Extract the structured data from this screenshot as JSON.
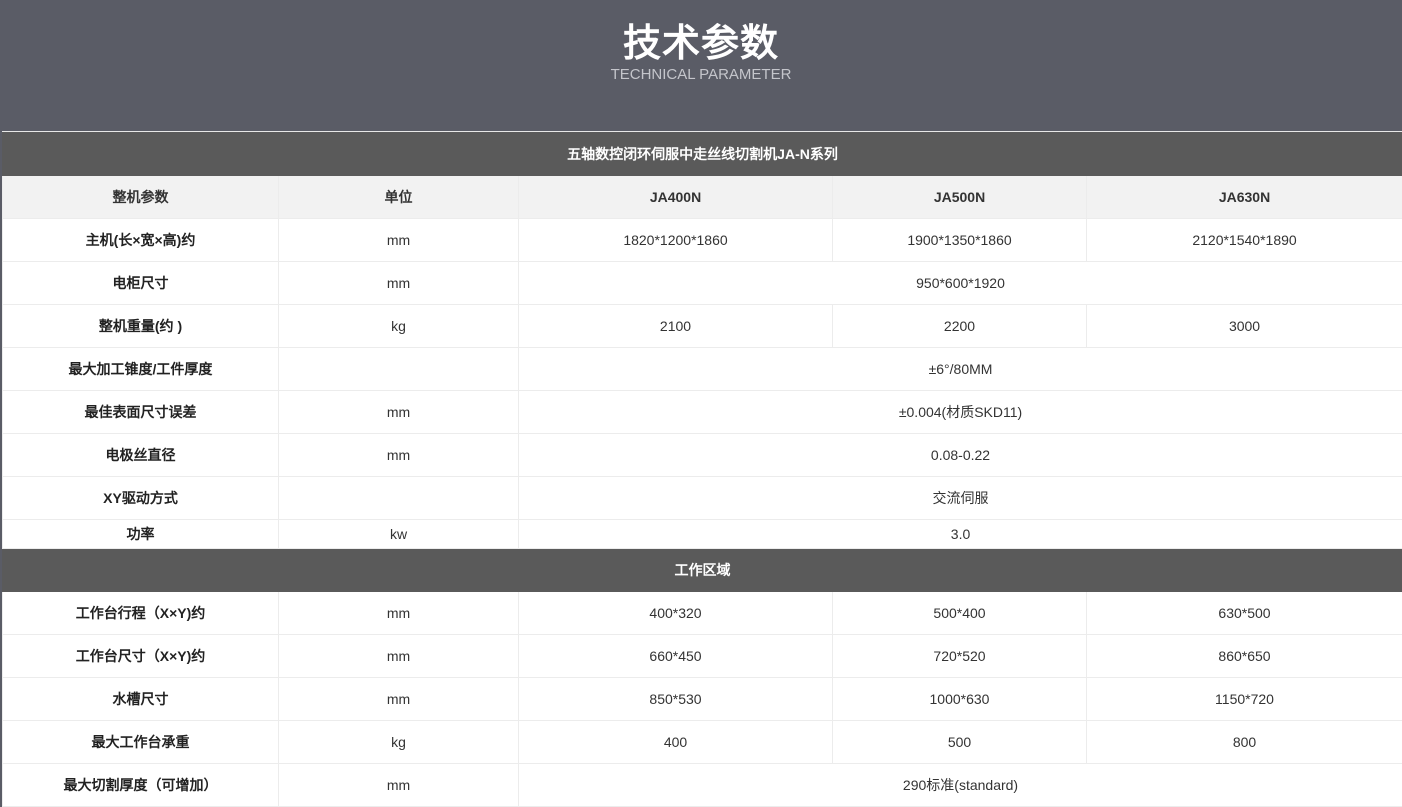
{
  "header": {
    "title": "技术参数",
    "subtitle": "TECHNICAL PARAMETER"
  },
  "table": {
    "section1_title": "五轴数控闭环伺服中走丝线切割机JA-N系列",
    "columns": [
      "整机参数",
      "单位",
      "JA400N",
      "JA500N",
      "JA630N"
    ],
    "section1_rows": [
      {
        "label": "主机(长×宽×高)约",
        "unit": "mm",
        "v1": "1820*1200*1860",
        "v2": "1900*1350*1860",
        "v3": "2120*1540*1890"
      },
      {
        "label": "电柜尺寸",
        "unit": "mm",
        "span": "950*600*1920"
      },
      {
        "label": "整机重量(约 )",
        "unit": "kg",
        "v1": "2100",
        "v2": "2200",
        "v3": "3000"
      },
      {
        "label": "最大加工锥度/工件厚度",
        "unit": "",
        "span": "±6°/80MM"
      },
      {
        "label": "最佳表面尺寸误差",
        "unit": "mm",
        "span": "±0.004(材质SKD11)"
      },
      {
        "label": "电极丝直径",
        "unit": "mm",
        "span": "0.08-0.22"
      },
      {
        "label": "XY驱动方式",
        "unit": "",
        "span": "交流伺服"
      },
      {
        "label": "功率",
        "unit": "kw",
        "span": "3.0"
      }
    ],
    "section2_title": "工作区域",
    "section2_rows": [
      {
        "label": "工作台行程（X×Y)约",
        "unit": "mm",
        "v1": "400*320",
        "v2": "500*400",
        "v3": "630*500"
      },
      {
        "label": "工作台尺寸（X×Y)约",
        "unit": "mm",
        "v1": "660*450",
        "v2": "720*520",
        "v3": "860*650"
      },
      {
        "label": "水槽尺寸",
        "unit": "mm",
        "v1": "850*530",
        "v2": "1000*630",
        "v3": "1150*720"
      },
      {
        "label": "最大工作台承重",
        "unit": "kg",
        "v1": "400",
        "v2": "500",
        "v3": "800"
      },
      {
        "label": "最大切割厚度（可增加）",
        "unit": "mm",
        "span": "290标准(standard)"
      }
    ]
  }
}
